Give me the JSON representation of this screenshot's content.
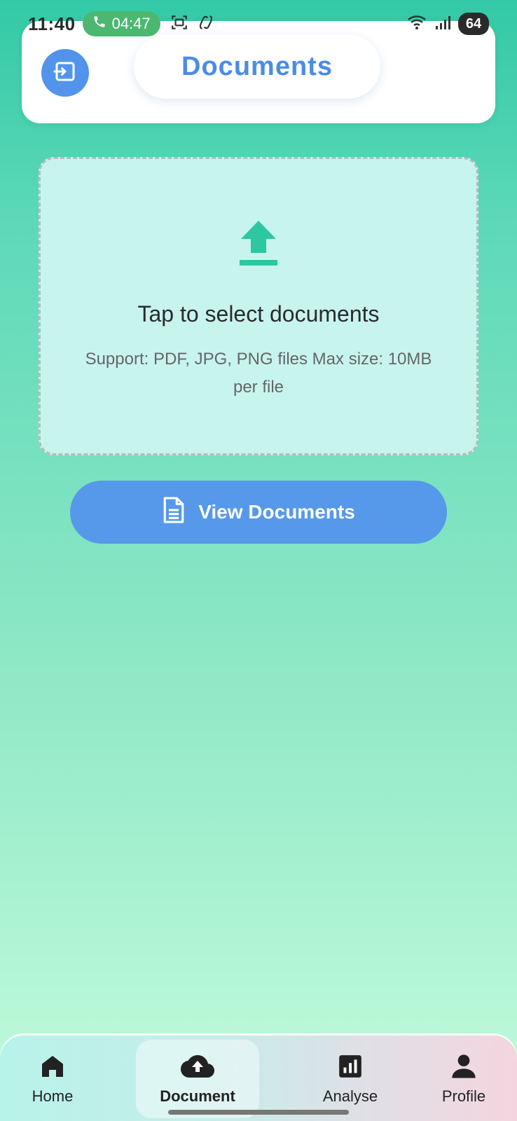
{
  "status_bar": {
    "time": "11:40",
    "call_timer": "04:47",
    "battery": "64",
    "icons": [
      "phone-icon",
      "screenshot-icon",
      "copilot-icon",
      "wifi-icon",
      "signal-icon"
    ]
  },
  "header": {
    "title": "Documents",
    "logout_icon": "logout-icon"
  },
  "upload": {
    "icon": "upload-icon",
    "title": "Tap to select documents",
    "subtitle": "Support: PDF, JPG, PNG files Max size: 10MB per file"
  },
  "view_button": {
    "icon": "document-icon",
    "label": "View Documents"
  },
  "bottom_nav": {
    "items": [
      {
        "label": "Home",
        "icon": "home-icon"
      },
      {
        "label": "Document",
        "icon": "cloud-upload-icon",
        "active": true
      },
      {
        "label": "Analyse",
        "icon": "bar-chart-icon"
      },
      {
        "label": "Profile",
        "icon": "person-icon"
      }
    ]
  },
  "colors": {
    "accent_blue": "#5294ec",
    "upload_green": "#2ec7a2",
    "title_blue": "#4b8ce6",
    "call_green": "#4cb771"
  }
}
